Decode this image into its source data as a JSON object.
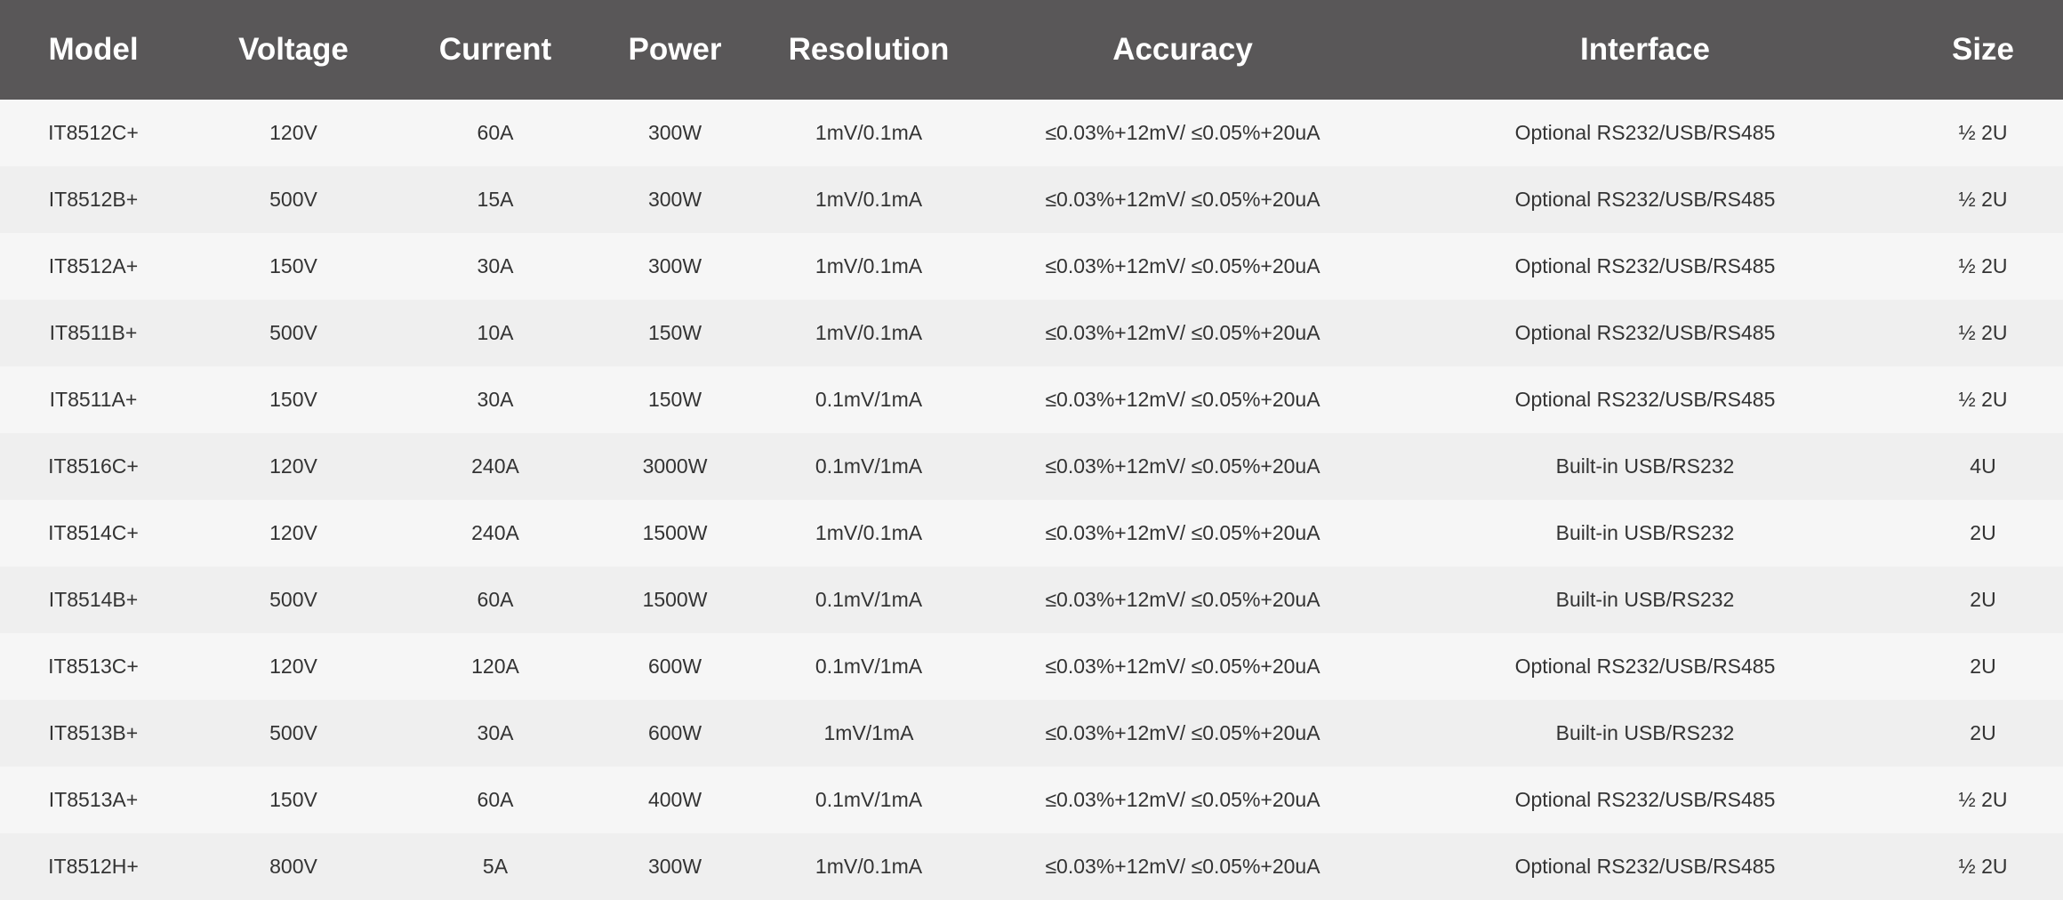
{
  "table": {
    "headers": [
      "Model",
      "Voltage",
      "Current",
      "Power",
      "Resolution",
      "Accuracy",
      "Interface",
      "Size"
    ],
    "rows": [
      [
        "IT8512C+",
        "120V",
        "60A",
        "300W",
        "1mV/0.1mA",
        "≤0.03%+12mV/ ≤0.05%+20uA",
        "Optional RS232/USB/RS485",
        "½ 2U"
      ],
      [
        "IT8512B+",
        "500V",
        "15A",
        "300W",
        "1mV/0.1mA",
        "≤0.03%+12mV/ ≤0.05%+20uA",
        "Optional RS232/USB/RS485",
        "½ 2U"
      ],
      [
        "IT8512A+",
        "150V",
        "30A",
        "300W",
        "1mV/0.1mA",
        "≤0.03%+12mV/ ≤0.05%+20uA",
        "Optional RS232/USB/RS485",
        "½ 2U"
      ],
      [
        "IT8511B+",
        "500V",
        "10A",
        "150W",
        "1mV/0.1mA",
        "≤0.03%+12mV/ ≤0.05%+20uA",
        "Optional RS232/USB/RS485",
        "½ 2U"
      ],
      [
        "IT8511A+",
        "150V",
        "30A",
        "150W",
        "0.1mV/1mA",
        "≤0.03%+12mV/ ≤0.05%+20uA",
        "Optional RS232/USB/RS485",
        "½ 2U"
      ],
      [
        "IT8516C+",
        "120V",
        "240A",
        "3000W",
        "0.1mV/1mA",
        "≤0.03%+12mV/ ≤0.05%+20uA",
        "Built-in USB/RS232",
        "4U"
      ],
      [
        "IT8514C+",
        "120V",
        "240A",
        "1500W",
        "1mV/0.1mA",
        "≤0.03%+12mV/ ≤0.05%+20uA",
        "Built-in USB/RS232",
        "2U"
      ],
      [
        "IT8514B+",
        "500V",
        "60A",
        "1500W",
        "0.1mV/1mA",
        "≤0.03%+12mV/ ≤0.05%+20uA",
        "Built-in USB/RS232",
        "2U"
      ],
      [
        "IT8513C+",
        "120V",
        "120A",
        "600W",
        "0.1mV/1mA",
        "≤0.03%+12mV/ ≤0.05%+20uA",
        "Optional RS232/USB/RS485",
        "2U"
      ],
      [
        "IT8513B+",
        "500V",
        "30A",
        "600W",
        "1mV/1mA",
        "≤0.03%+12mV/ ≤0.05%+20uA",
        "Built-in USB/RS232",
        "2U"
      ],
      [
        "IT8513A+",
        "150V",
        "60A",
        "400W",
        "0.1mV/1mA",
        "≤0.03%+12mV/ ≤0.05%+20uA",
        "Optional RS232/USB/RS485",
        "½ 2U"
      ],
      [
        "IT8512H+",
        "800V",
        "5A",
        "300W",
        "1mV/0.1mA",
        "≤0.03%+12mV/ ≤0.05%+20uA",
        "Optional RS232/USB/RS485",
        "½ 2U"
      ]
    ]
  }
}
